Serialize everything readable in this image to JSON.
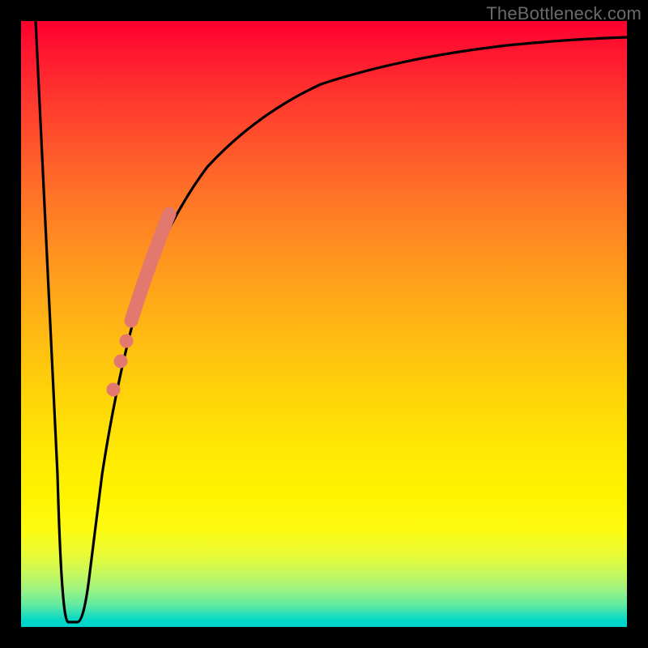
{
  "watermark": "TheBottleneck.com",
  "colors": {
    "background": "#000000",
    "curve": "#000000",
    "highlight": "#e2786e",
    "gradient_top": "#ff002f",
    "gradient_bottom": "#00d3cc"
  },
  "chart_data": {
    "type": "line",
    "title": "",
    "xlabel": "",
    "ylabel": "",
    "xlim": [
      0,
      100
    ],
    "ylim": [
      0,
      100
    ],
    "annotations": [
      {
        "text": "TheBottleneck.com",
        "pos": "top-right"
      }
    ],
    "series": [
      {
        "name": "bottleneck-curve",
        "x": [
          0,
          4,
          6,
          7,
          8,
          9,
          10,
          11,
          12,
          14,
          16,
          18,
          20,
          23,
          26,
          30,
          35,
          40,
          48,
          58,
          70,
          85,
          100
        ],
        "values": [
          100,
          50,
          20,
          5,
          2,
          2,
          5,
          15,
          25,
          38,
          48,
          55,
          62,
          68,
          73,
          78,
          82,
          85,
          88,
          91,
          93,
          94,
          95
        ]
      },
      {
        "name": "highlight-segment",
        "x": [
          14,
          15,
          16,
          17,
          18,
          19,
          20,
          21
        ],
        "values": [
          38,
          43,
          48,
          52,
          55,
          59,
          62,
          65
        ]
      },
      {
        "name": "highlight-dots",
        "x": [
          13.0,
          13.6,
          14.3
        ],
        "values": [
          33,
          36,
          39
        ]
      }
    ]
  }
}
